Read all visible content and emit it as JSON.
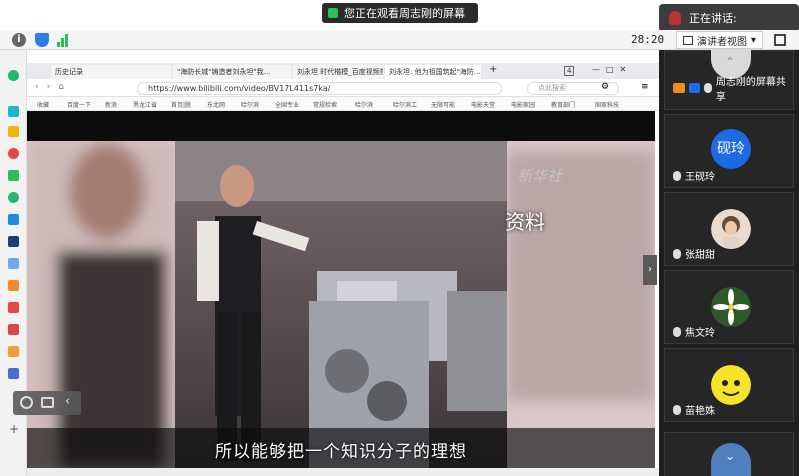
{
  "meeting": {
    "share_banner": "您正在观看周志刚的屏幕",
    "speaking_label": "正在讲话:",
    "timer": "28:20",
    "view_mode": "演讲者视图",
    "view_mode_caret": "▾"
  },
  "participants": {
    "presenter": "周志刚的屏幕共享",
    "items": [
      {
        "name": "王砚玲",
        "avatar_text": "砚玲"
      },
      {
        "name": "张甜甜",
        "avatar_text": ""
      },
      {
        "name": "焦文玲",
        "avatar_text": ""
      },
      {
        "name": "苗艳姝",
        "avatar_text": ""
      }
    ]
  },
  "browser": {
    "tabs": [
      "历史记录",
      "\"海防长城\"铸造者刘永坦\"我…",
      "刘永坦 时代楷模_百度视频搜索",
      "刘永坦: 他为祖国筑起\"海防…"
    ],
    "tab_count": "4",
    "url": "https://www.bilibili.com/video/BV17L411s7ka/",
    "search_placeholder": "点此搜索",
    "bookmarks": [
      "收藏",
      "百度一下",
      "新浪",
      "黑龙江省",
      "首页|脱",
      "东北网",
      "哈尔滨",
      "全国专业",
      "常规检索",
      "哈尔滨",
      "哈尔滨工",
      "无限可能",
      "电影天堂",
      "电影家园",
      "教育部门",
      "国家科技"
    ]
  },
  "video": {
    "overlay_label": "资料",
    "watermark": "新华社",
    "subtitle": "所以能够把一个知识分子的理想"
  },
  "colors": {
    "accent_blue": "#1d6ae5",
    "share_green": "#2ebd59"
  }
}
